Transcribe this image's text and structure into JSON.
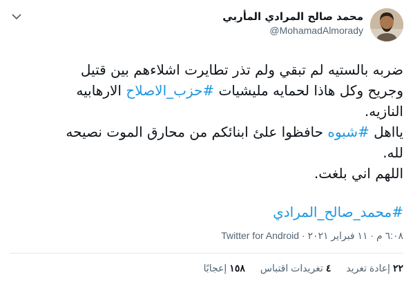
{
  "author": {
    "name": "محمد صالح المرادي المأربي",
    "handle": "@MohamadAlmorady"
  },
  "tweet": {
    "line1": "ضربه بالستيه لم تبقي ولم تذر تطايرت اشلاءهم بين قتيل",
    "line2_pre": "وجريح وكل هاذا لحمايه مليشيات ",
    "hashtag1": "#حزب_الاصلاح",
    "line2_post": " الارهابيه",
    "line3": "النازيه.",
    "line4_pre": "يااهل ",
    "hashtag2": "#شبوه",
    "line4_post": " حافظوا علئ ابنائكم من محارق الموت  نصيحه",
    "line5": "لله.",
    "line6": "اللهم اني بلغت.",
    "hashtag3": "#محمد_صالح_المرادي"
  },
  "meta": {
    "time": "٦:٠٨ م",
    "separator": "·",
    "date": "١١ فبراير ٢٠٢١",
    "source": "Twitter for Android"
  },
  "stats": {
    "retweets_count": "٢٢",
    "retweets_label": "إعادة تغريد",
    "quotes_count": "٤",
    "quotes_label": "تغريدات اقتباس",
    "likes_count": "١٥٨",
    "likes_label": "إعجابًا"
  },
  "icons": {
    "caret": "chevron-down-icon"
  },
  "colors": {
    "link": "#1b95e0",
    "text": "#0f1419",
    "muted": "#536471"
  }
}
